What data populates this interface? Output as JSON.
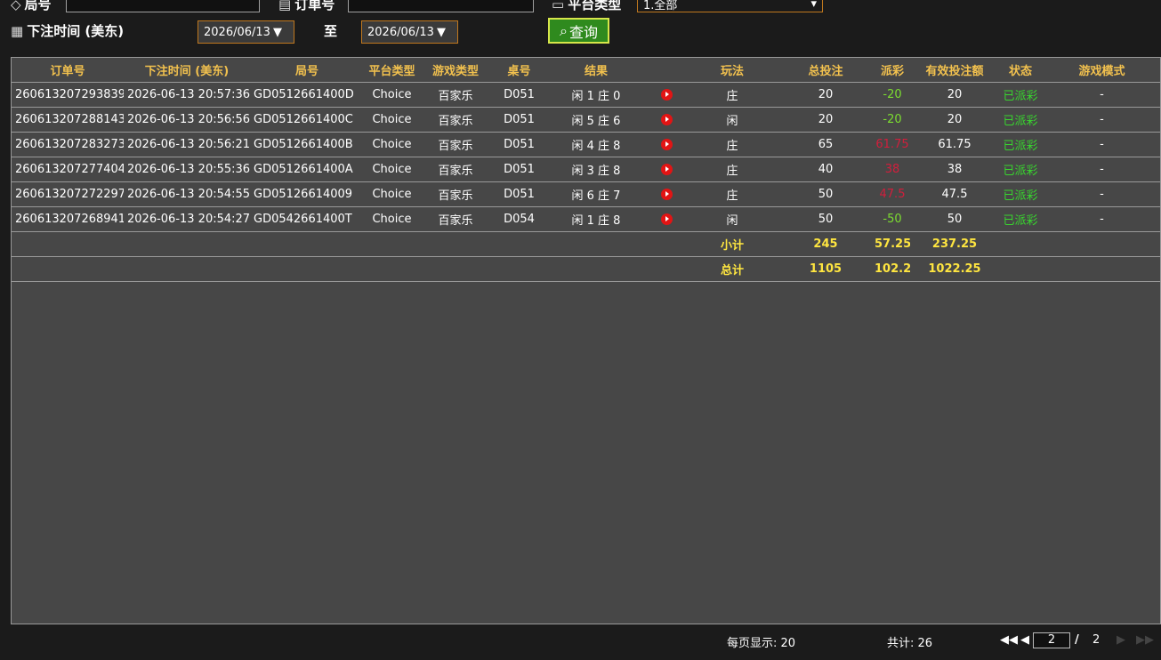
{
  "filters": {
    "round_label": "局号",
    "round_value": "",
    "order_label": "订单号",
    "order_value": "",
    "platform_label": "平台类型",
    "platform_selected": "1.全部",
    "time_label": "下注时间 (美东)",
    "date_from": "2026/06/13",
    "to_label": "至",
    "date_to": "2026/06/13",
    "query_label": "查询"
  },
  "table": {
    "headers": [
      "订单号",
      "下注时间 (美东)",
      "局号",
      "平台类型",
      "游戏类型",
      "桌号",
      "结果",
      "",
      "玩法",
      "总投注",
      "派彩",
      "有效投注额",
      "状态",
      "游戏模式"
    ],
    "rows": [
      {
        "order": "260613207293839",
        "time": "2026-06-13 20:57:36",
        "round": "GD0512661400D",
        "platform": "Choice",
        "game": "百家乐",
        "table": "D051",
        "result": "闲 1 庄 0",
        "bet": "庄",
        "total": "20",
        "payout": "-20",
        "payout_color": "pos",
        "valid": "20",
        "status": "已派彩",
        "mode": "-"
      },
      {
        "order": "260613207288143",
        "time": "2026-06-13 20:56:56",
        "round": "GD0512661400C",
        "platform": "Choice",
        "game": "百家乐",
        "table": "D051",
        "result": "闲 5 庄 6",
        "bet": "闲",
        "total": "20",
        "payout": "-20",
        "payout_color": "pos",
        "valid": "20",
        "status": "已派彩",
        "mode": "-"
      },
      {
        "order": "260613207283273",
        "time": "2026-06-13 20:56:21",
        "round": "GD0512661400B",
        "platform": "Choice",
        "game": "百家乐",
        "table": "D051",
        "result": "闲 4 庄 8",
        "bet": "庄",
        "total": "65",
        "payout": "61.75",
        "payout_color": "neg",
        "valid": "61.75",
        "status": "已派彩",
        "mode": "-"
      },
      {
        "order": "260613207277404",
        "time": "2026-06-13 20:55:36",
        "round": "GD0512661400A",
        "platform": "Choice",
        "game": "百家乐",
        "table": "D051",
        "result": "闲 3 庄 8",
        "bet": "庄",
        "total": "40",
        "payout": "38",
        "payout_color": "neg",
        "valid": "38",
        "status": "已派彩",
        "mode": "-"
      },
      {
        "order": "260613207272297",
        "time": "2026-06-13 20:54:55",
        "round": "GD05126614009",
        "platform": "Choice",
        "game": "百家乐",
        "table": "D051",
        "result": "闲 6 庄 7",
        "bet": "庄",
        "total": "50",
        "payout": "47.5",
        "payout_color": "neg",
        "valid": "47.5",
        "status": "已派彩",
        "mode": "-"
      },
      {
        "order": "260613207268941",
        "time": "2026-06-13 20:54:27",
        "round": "GD0542661400T",
        "platform": "Choice",
        "game": "百家乐",
        "table": "D054",
        "result": "闲 1 庄 8",
        "bet": "闲",
        "total": "50",
        "payout": "-50",
        "payout_color": "pos",
        "valid": "50",
        "status": "已派彩",
        "mode": "-"
      }
    ],
    "subtotal": {
      "label": "小计",
      "total": "245",
      "payout": "57.25",
      "valid": "237.25"
    },
    "grandtotal": {
      "label": "总计",
      "total": "1105",
      "payout": "102.25",
      "valid": "1022.25"
    }
  },
  "footer": {
    "per_page": "每页显示: 20",
    "total_count": "共计: 26",
    "current_page": "2",
    "page_sep": "/",
    "total_pages": "2"
  },
  "colors": {
    "header_text": "#f2c14e",
    "payout_positive": "#7cdd30",
    "payout_negative": "#d21e3c",
    "status": "#38d62e",
    "summary": "#ffe640",
    "accent_border": "#c0781e",
    "query_button": "#2f8a1e"
  }
}
